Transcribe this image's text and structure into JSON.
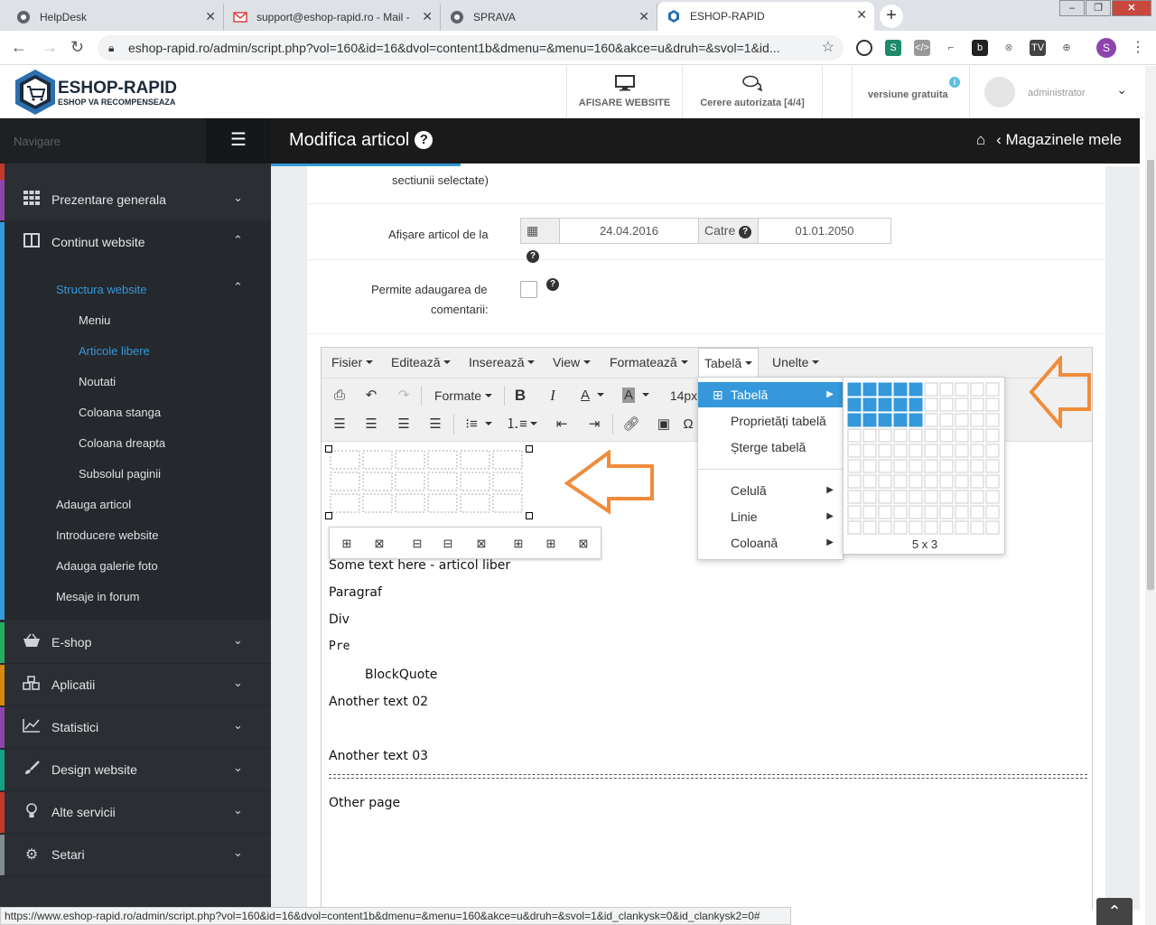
{
  "browser": {
    "tabs": [
      {
        "title": "HelpDesk"
      },
      {
        "title": "support@eshop-rapid.ro - Mail -"
      },
      {
        "title": "SPRAVA"
      },
      {
        "title": "ESHOP-RAPID"
      }
    ],
    "url": "eshop-rapid.ro/admin/script.php?vol=160&id=16&dvol=content1b&dmenu=&menu=160&akce=u&druh=&svol=1&id...",
    "profile_initial": "S",
    "status_url": "https://www.eshop-rapid.ro/admin/script.php?vol=160&id=16&dvol=content1b&dmenu=&menu=160&akce=u&druh=&svol=1&id_clankysk=0&id_clankysk2=0#"
  },
  "header": {
    "logo_title": "ESHOP-RAPID",
    "logo_subtitle": "ESHOP VA RECOMPENSEAZA",
    "btn_website": "AFISARE WEBSITE",
    "btn_requests": "Cerere autorizata [4/4]",
    "version": "versiune gratuita",
    "user": "administrator"
  },
  "sidebar": {
    "nav_label": "Navigare",
    "items": [
      {
        "label": "Prezentare generala",
        "icon": "grid-icon",
        "color": "#8e44ad"
      },
      {
        "label": "Continut website",
        "icon": "columns-icon",
        "color": "#3498db"
      },
      {
        "label": "E-shop",
        "icon": "basket-icon",
        "color": "#27ae60"
      },
      {
        "label": "Aplicatii",
        "icon": "cubes-icon",
        "color": "#d68910"
      },
      {
        "label": "Statistici",
        "icon": "chart-icon",
        "color": "#8e44ad"
      },
      {
        "label": "Design website",
        "icon": "brush-icon",
        "color": "#16a085"
      },
      {
        "label": "Alte servicii",
        "icon": "bulb-icon",
        "color": "#c0392b"
      },
      {
        "label": "Setari",
        "icon": "gears-icon",
        "color": "#7f8c8d"
      }
    ],
    "sub": {
      "structura": "Structura website",
      "meniu": "Meniu",
      "articole": "Articole libere",
      "noutati": "Noutati",
      "stanga": "Coloana stanga",
      "dreapta": "Coloana dreapta",
      "subsol": "Subsolul paginii",
      "adauga": "Adauga articol",
      "introducere": "Introducere website",
      "galerie": "Adauga galerie foto",
      "mesaje": "Mesaje in forum"
    }
  },
  "page": {
    "title": "Modifica articol",
    "breadcrumb": "Magazinele mele"
  },
  "form": {
    "sect_label": "sectiunii selectate)",
    "display_label": "Afișare articol de la",
    "date_from": "24.04.2016",
    "to_label": "Catre",
    "date_to": "01.01.2050",
    "comments_label_1": "Permite adaugarea de",
    "comments_label_2": "comentarii:"
  },
  "editor": {
    "menu": [
      "Fisier",
      "Editează",
      "Inserează",
      "View",
      "Formatează",
      "Tabelă",
      "Unelte"
    ],
    "formats_label": "Formate",
    "font_size": "14px",
    "content": {
      "line1": "Some text here - articol liber",
      "line2": "Paragraf",
      "line3": "Div",
      "line4": "Pre",
      "line5": "BlockQuote",
      "line6": "Another text 02",
      "line7": "Another text 03",
      "line8": "Other page"
    },
    "table_menu": {
      "table": "Tabelă",
      "props": "Proprietăți tabelă",
      "delete": "Șterge tabelă",
      "cell": "Celulă",
      "row": "Linie",
      "col": "Coloană"
    },
    "grid_label": "5 x 3",
    "grid_cols": 10,
    "grid_rows": 10,
    "grid_selected_cols": 5,
    "grid_selected_rows": 3
  },
  "colors": {
    "accent": "#3498db",
    "arrow": "#f08c3a",
    "sidebar": "#2b2e33"
  }
}
